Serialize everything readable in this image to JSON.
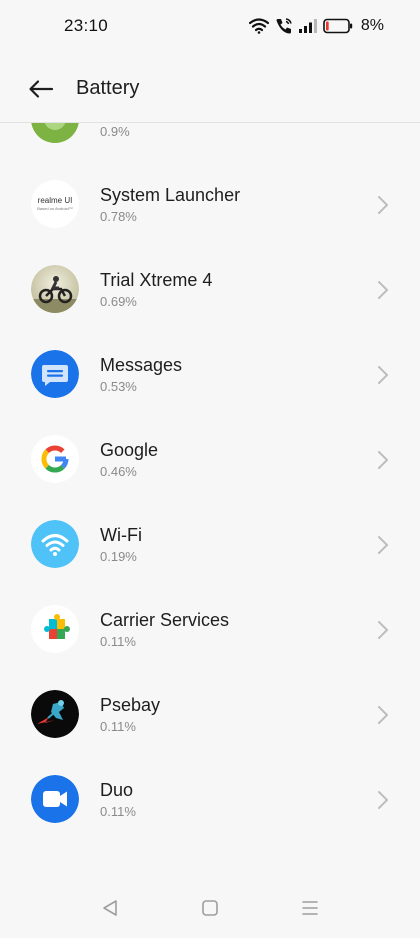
{
  "status_bar": {
    "time": "23:10",
    "battery_percent": "8%",
    "battery_level": 0.08,
    "battery_color": "#e53935"
  },
  "header": {
    "title": "Battery",
    "back_icon": "arrow-left-icon"
  },
  "apps": [
    {
      "name": "",
      "percent": "0.9%",
      "icon": "partial-app-icon"
    },
    {
      "name": "System Launcher",
      "percent": "0.78%",
      "icon": "realme-ui-icon",
      "icon_text": "realme UI",
      "icon_subtext": "Based on Android™"
    },
    {
      "name": "Trial Xtreme 4",
      "percent": "0.69%",
      "icon": "motorbike-game-icon"
    },
    {
      "name": "Messages",
      "percent": "0.53%",
      "icon": "messages-icon"
    },
    {
      "name": "Google",
      "percent": "0.46%",
      "icon": "google-g-icon"
    },
    {
      "name": "Wi-Fi",
      "percent": "0.19%",
      "icon": "wifi-icon"
    },
    {
      "name": "Carrier Services",
      "percent": "0.11%",
      "icon": "carrier-services-icon"
    },
    {
      "name": "Psebay",
      "percent": "0.11%",
      "icon": "psebay-icon"
    },
    {
      "name": "Duo",
      "percent": "0.11%",
      "icon": "duo-camera-icon"
    }
  ],
  "nav_bar": {
    "back": "triangle-back-icon",
    "home": "square-home-icon",
    "recents": "menu-lines-icon"
  },
  "colors": {
    "background": "#f7f7f7",
    "messages_blue": "#1a73e8",
    "wifi_blue": "#4fc3f7",
    "duo_blue": "#1a73e8"
  }
}
